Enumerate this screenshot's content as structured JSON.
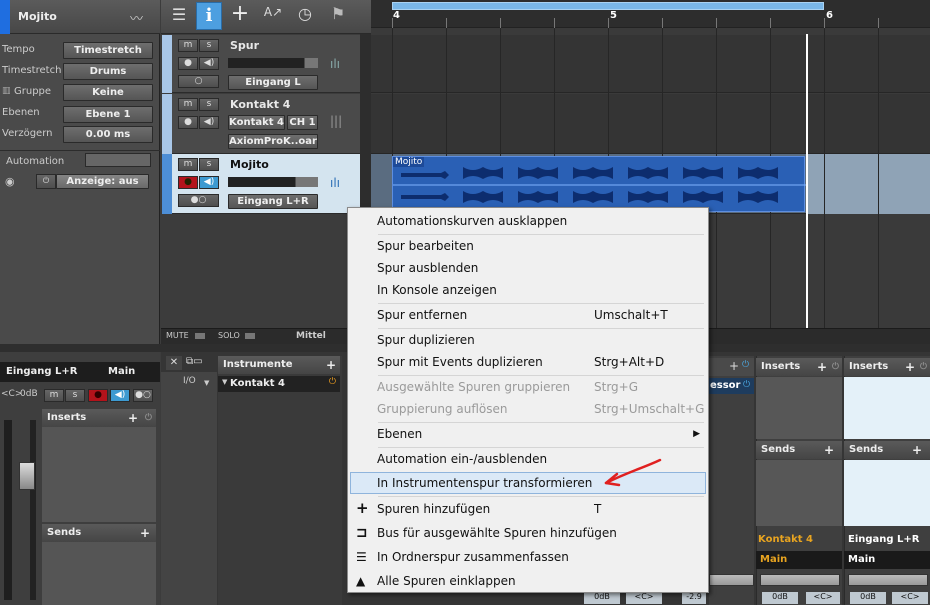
{
  "inspector": {
    "track_name": "Mojito",
    "rows": [
      {
        "label": "Tempo",
        "value": "Timestretch"
      },
      {
        "label": "Timestretch",
        "value": "Drums"
      },
      {
        "label": "Gruppe",
        "value": "Keine"
      },
      {
        "label": "Ebenen",
        "value": "Ebene 1"
      },
      {
        "label": "Verzögern",
        "value": "0.00 ms"
      }
    ],
    "automation_label": "Automation",
    "automation_display": "Anzeige: aus"
  },
  "toolbar": {
    "icons": [
      "list-icon",
      "info-icon",
      "add-icon",
      "automation-icon",
      "clock-icon",
      "flag-icon"
    ]
  },
  "ruler": {
    "marks": [
      "4",
      "5",
      "6"
    ]
  },
  "tracks": [
    {
      "name": "Spur",
      "m": "m",
      "s": "s",
      "input": "Eingang L"
    },
    {
      "name": "Kontakt 4",
      "m": "m",
      "s": "s",
      "instrument": "Kontakt 4",
      "channel": "CH 1",
      "input": "AxiomProK..oard"
    },
    {
      "name": "Mojito",
      "m": "m",
      "s": "s",
      "input": "Eingang L+R"
    }
  ],
  "event": {
    "name": "Mojito"
  },
  "footer": {
    "mute": "MUTE",
    "solo": "SOLO",
    "mid": "Mittel"
  },
  "mixer_left": {
    "input": "Eingang L+R",
    "output": "Main",
    "lr": "<C>",
    "db": "0dB",
    "inserts": "Inserts",
    "sends": "Sends"
  },
  "browser": {
    "tab": "Instrumente",
    "io": "I/O",
    "item": "Kontakt 4"
  },
  "mixer_right": {
    "strip_a": {
      "name": "essor"
    },
    "strip_b": {
      "inserts": "Inserts",
      "sends": "Sends",
      "name": "Kontakt 4",
      "out": "Main",
      "db": "0dB",
      "pan": "<C>"
    },
    "strip_c": {
      "inserts": "Inserts",
      "sends": "Sends",
      "name": "Eingang L+R",
      "out": "Main",
      "db": "0dB",
      "pan": "<C>"
    },
    "left_db": "0dB",
    "left_pan": "<C>",
    "mid_db": "-2.9"
  },
  "context_menu": {
    "items": [
      {
        "label": "Automationskurven ausklappen",
        "shortcut": ""
      },
      {
        "label": "Spur bearbeiten",
        "shortcut": ""
      },
      {
        "label": "Spur ausblenden",
        "shortcut": ""
      },
      {
        "label": "In Konsole anzeigen",
        "shortcut": ""
      },
      {
        "label": "Spur entfernen",
        "shortcut": "Umschalt+T"
      },
      {
        "label": "Spur duplizieren",
        "shortcut": ""
      },
      {
        "label": "Spur mit Events duplizieren",
        "shortcut": "Strg+Alt+D"
      },
      {
        "label": "Ausgewählte Spuren gruppieren",
        "shortcut": "Strg+G",
        "disabled": true
      },
      {
        "label": "Gruppierung auflösen",
        "shortcut": "Strg+Umschalt+G",
        "disabled": true
      },
      {
        "label": "Ebenen",
        "shortcut": "",
        "submenu": true
      },
      {
        "label": "Automation ein-/ausblenden",
        "shortcut": ""
      },
      {
        "label": "In Instrumentenspur transformieren",
        "shortcut": "",
        "highlighted": true
      },
      {
        "label": "Spuren hinzufügen",
        "shortcut": "T",
        "icon": "plus-icon"
      },
      {
        "label": "Bus für ausgewählte Spuren hinzufügen",
        "shortcut": "",
        "icon": "bus-icon"
      },
      {
        "label": "In Ordnerspur zusammenfassen",
        "shortcut": "",
        "icon": "folder-track-icon"
      },
      {
        "label": "Alle Spuren einklappen",
        "shortcut": "",
        "icon": "collapse-icon"
      }
    ]
  },
  "colors": {
    "accent": "#4a9ad8",
    "event": "#2a60b5",
    "annotation": "#e02020"
  }
}
